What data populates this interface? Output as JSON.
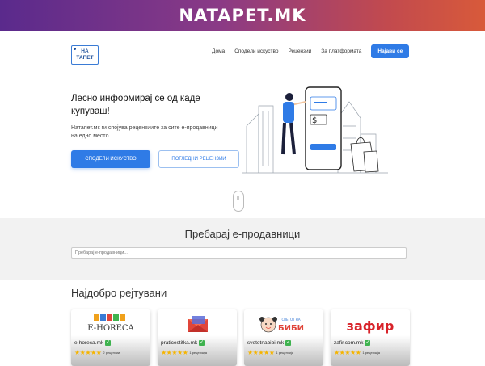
{
  "banner": {
    "title": "NATAPET.MK"
  },
  "logo": {
    "line1": "НА",
    "line2": "ТАПЕТ"
  },
  "nav": {
    "items": [
      "Дома",
      "Сподели искуство",
      "Рецензии",
      "За платформата"
    ],
    "login_label": "Најави се"
  },
  "hero": {
    "title": "Лесно информирај се од каде купуваш!",
    "subtitle": "Натапет.мк ги спојува рецензиите за сите е-продавници на едно место.",
    "share_button": "СПОДЕЛИ ИСКУСТВО",
    "reviews_button": "ПОГЛЕДНИ РЕЦЕНЗИИ"
  },
  "search": {
    "title": "Пребарај е-продавници",
    "placeholder": "Пребарај е-продавници..."
  },
  "top_rated": {
    "title": "Најдобро рејтувани",
    "cards": [
      {
        "name": "e-horeca.mk",
        "logo_text": "E-HORECA",
        "rating": 5,
        "count": "2 рецензии",
        "verified": true
      },
      {
        "name": "praticestitka.mk",
        "logo_text": "",
        "rating": 5,
        "count": "1 рецензија",
        "verified": true
      },
      {
        "name": "svetotnabibi.mk",
        "logo_text": "БИБИ",
        "logo_subtext": "СВЕТОТ НА",
        "rating": 5,
        "count": "1 рецензија",
        "verified": true
      },
      {
        "name": "zafir.com.mk",
        "logo_text": "зафир",
        "rating": 5,
        "count": "1 рецензија",
        "verified": true
      }
    ]
  },
  "colors": {
    "primary": "#2f7be6",
    "banner_start": "#5a2a8c",
    "banner_end": "#d85a3a",
    "star": "#f5b400",
    "verified": "#3fb34f"
  }
}
